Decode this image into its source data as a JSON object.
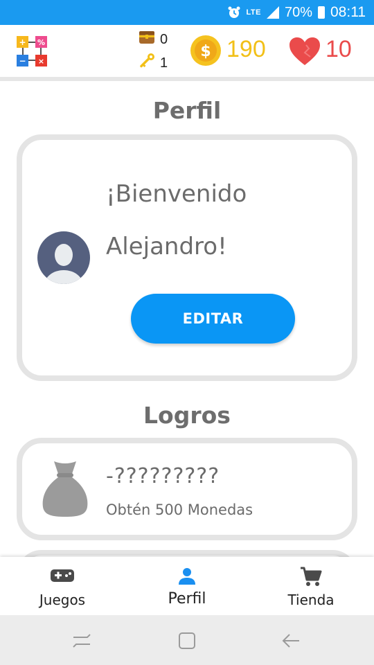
{
  "status_bar": {
    "network": "LTE",
    "battery_percent": "70%",
    "time": "08:11",
    "icons": [
      "alarm-icon",
      "signal-icon",
      "battery-icon"
    ]
  },
  "header": {
    "chests": "0",
    "keys": "1",
    "coins": "190",
    "lives": "10",
    "icons": [
      "app-logo",
      "chest-icon",
      "key-icon",
      "coin-icon",
      "heart-icon"
    ]
  },
  "profile": {
    "title": "Perfil",
    "welcome": "¡Bienvenido",
    "name": "Alejandro!",
    "edit_label": "EDITAR"
  },
  "achievements": {
    "title": "Logros",
    "items": [
      {
        "title": "-?????????",
        "description": "Obtén 500 Monedas",
        "icon": "moneybag-icon"
      }
    ]
  },
  "bottom_nav": {
    "items": [
      {
        "label": "Juegos",
        "icon": "gamepad-icon"
      },
      {
        "label": "Perfil",
        "icon": "person-icon",
        "active": true
      },
      {
        "label": "Tienda",
        "icon": "cart-icon"
      }
    ]
  },
  "colors": {
    "status_bar": "#1a9af0",
    "accent": "#0a96f5",
    "coin": "#f2c018",
    "heart": "#ea4b4b",
    "card_border": "#e4e4e4"
  }
}
